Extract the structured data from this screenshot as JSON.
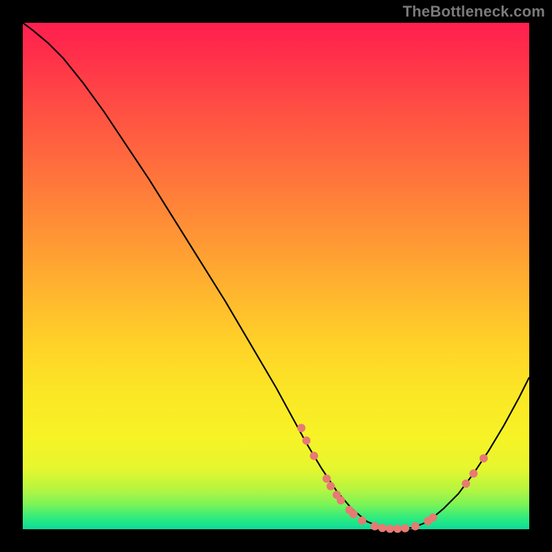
{
  "watermark": "TheBottleneck.com",
  "colors": {
    "background": "#000000",
    "curve": "#000000",
    "marker": "#e77a73",
    "watermark": "#7a7a7a"
  },
  "chart_data": {
    "type": "line",
    "title": "",
    "xlabel": "",
    "ylabel": "",
    "xlim": [
      0,
      100
    ],
    "ylim": [
      0,
      100
    ],
    "x": [
      0,
      2,
      5,
      8,
      12,
      16,
      20,
      25,
      30,
      35,
      40,
      45,
      50,
      53,
      56,
      59,
      62,
      65,
      68,
      71,
      74,
      77,
      80,
      83,
      86,
      89,
      92,
      95,
      98,
      100
    ],
    "y": [
      100,
      98.5,
      96,
      93,
      88,
      82.5,
      76.5,
      69,
      61,
      53,
      45,
      36.5,
      28,
      22.5,
      17,
      12,
      7.5,
      4,
      1.5,
      0.3,
      0,
      0.3,
      1.5,
      4,
      7,
      11,
      15.5,
      20.5,
      26,
      30
    ],
    "markers": [
      {
        "x": 55.0,
        "y": 20.0
      },
      {
        "x": 56.0,
        "y": 17.5
      },
      {
        "x": 57.5,
        "y": 14.5
      },
      {
        "x": 60.0,
        "y": 10.0
      },
      {
        "x": 60.8,
        "y": 8.5
      },
      {
        "x": 62.0,
        "y": 6.8
      },
      {
        "x": 62.8,
        "y": 5.7
      },
      {
        "x": 64.5,
        "y": 3.8
      },
      {
        "x": 65.3,
        "y": 3.0
      },
      {
        "x": 67.0,
        "y": 1.7
      },
      {
        "x": 69.5,
        "y": 0.6
      },
      {
        "x": 71.0,
        "y": 0.25
      },
      {
        "x": 72.5,
        "y": 0.1
      },
      {
        "x": 74.0,
        "y": 0.1
      },
      {
        "x": 75.5,
        "y": 0.2
      },
      {
        "x": 77.5,
        "y": 0.6
      },
      {
        "x": 80.0,
        "y": 1.6
      },
      {
        "x": 81.0,
        "y": 2.3
      },
      {
        "x": 87.5,
        "y": 9.0
      },
      {
        "x": 89.0,
        "y": 11.0
      },
      {
        "x": 91.0,
        "y": 14.0
      }
    ]
  }
}
